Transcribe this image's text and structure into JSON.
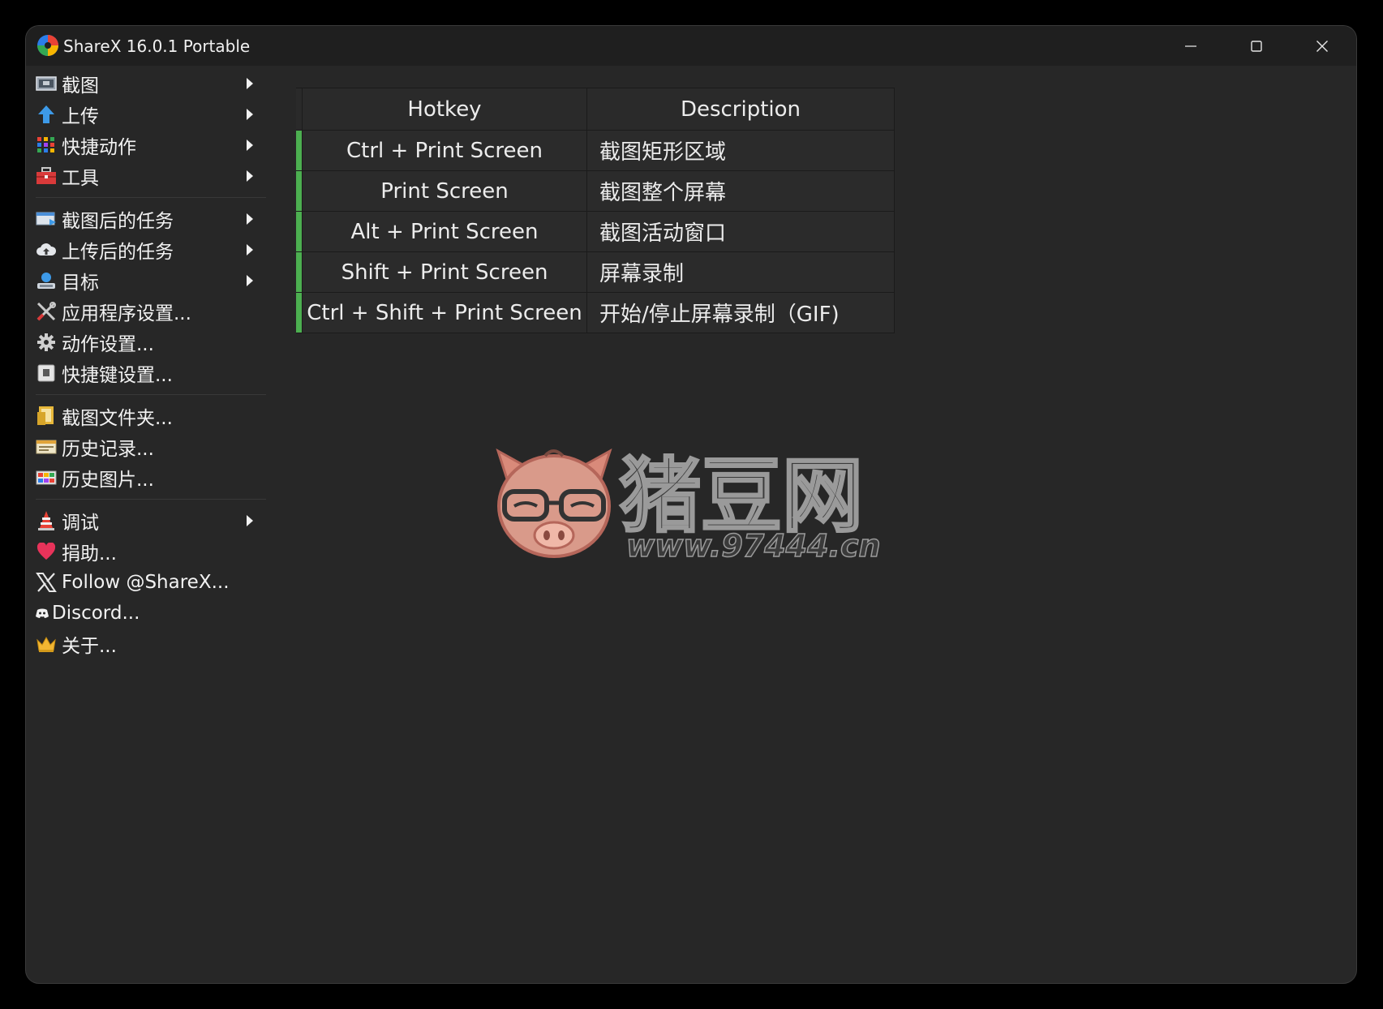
{
  "window": {
    "title": "ShareX 16.0.1 Portable",
    "buttons": {
      "minimize": "minimize-icon",
      "maximize": "maximize-icon",
      "close": "close-icon"
    }
  },
  "menu": {
    "items": [
      {
        "label": "截图",
        "icon": "capture-icon",
        "submenu": true
      },
      {
        "label": "上传",
        "icon": "upload-icon",
        "submenu": true
      },
      {
        "label": "快捷动作",
        "icon": "workflows-icon",
        "submenu": true
      },
      {
        "label": "工具",
        "icon": "toolbox-icon",
        "submenu": true
      },
      {
        "label": "截图后的任务",
        "icon": "after-capture-icon",
        "submenu": true
      },
      {
        "label": "上传后的任务",
        "icon": "after-upload-icon",
        "submenu": true
      },
      {
        "label": "目标",
        "icon": "destinations-icon",
        "submenu": true
      },
      {
        "label": "应用程序设置...",
        "icon": "app-settings-icon",
        "submenu": false
      },
      {
        "label": "动作设置...",
        "icon": "gear-icon",
        "submenu": false
      },
      {
        "label": "快捷键设置...",
        "icon": "keyboard-icon",
        "submenu": false
      },
      {
        "label": "截图文件夹...",
        "icon": "folder-icon",
        "submenu": false
      },
      {
        "label": "历史记录...",
        "icon": "history-icon",
        "submenu": false
      },
      {
        "label": "历史图片...",
        "icon": "image-history-icon",
        "submenu": false
      },
      {
        "label": "调试",
        "icon": "debug-icon",
        "submenu": true
      },
      {
        "label": "捐助...",
        "icon": "heart-icon",
        "submenu": false
      },
      {
        "label": "Follow @ShareX...",
        "icon": "x-logo-icon",
        "submenu": false
      },
      {
        "label": "Discord...",
        "icon": "discord-icon",
        "submenu": false
      },
      {
        "label": "关于...",
        "icon": "crown-icon",
        "submenu": false
      }
    ]
  },
  "hotkeys": {
    "columns": [
      "Hotkey",
      "Description"
    ],
    "rows": [
      {
        "hotkey": "Ctrl + Print Screen",
        "description": "截图矩形区域"
      },
      {
        "hotkey": "Print Screen",
        "description": "截图整个屏幕"
      },
      {
        "hotkey": "Alt + Print Screen",
        "description": "截图活动窗口"
      },
      {
        "hotkey": "Shift + Print Screen",
        "description": "屏幕录制"
      },
      {
        "hotkey": "Ctrl + Shift + Print Screen",
        "description": "开始/停止屏幕录制（GIF)"
      }
    ],
    "status_color": "#4caf50"
  },
  "watermark": {
    "brand": "猪豆网",
    "url": "www.97444.cn"
  }
}
